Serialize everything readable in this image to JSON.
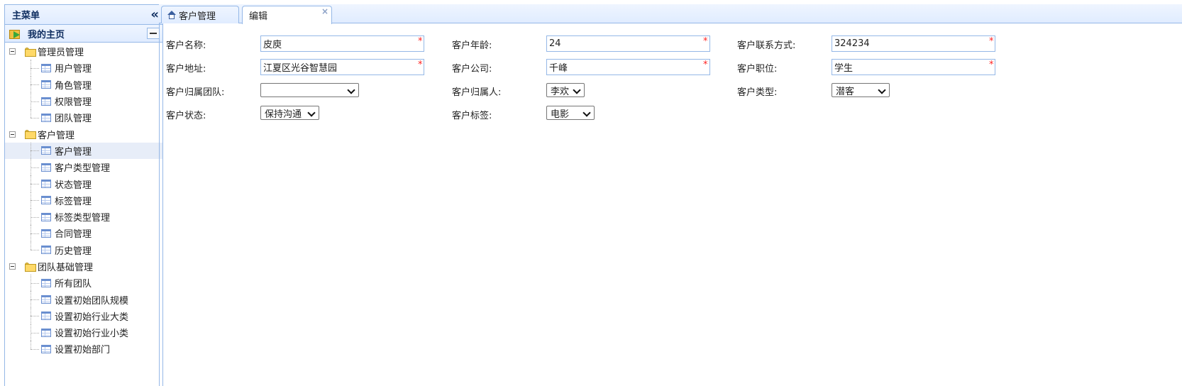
{
  "sidebar": {
    "title": "主菜单",
    "collapse_glyph": "«",
    "home_label": "我的主页",
    "groups": [
      {
        "label": "管理员管理",
        "children": [
          "用户管理",
          "角色管理",
          "权限管理",
          "团队管理"
        ]
      },
      {
        "label": "客户管理",
        "children": [
          "客户管理",
          "客户类型管理",
          "状态管理",
          "标签管理",
          "标签类型管理",
          "合同管理",
          "历史管理"
        ]
      },
      {
        "label": "团队基础管理",
        "children": [
          "所有团队",
          "设置初始团队规模",
          "设置初始行业大类",
          "设置初始行业小类",
          "设置初始部门"
        ]
      }
    ]
  },
  "tabs": {
    "customer": "客户管理",
    "edit": "编辑",
    "close_glyph": "×"
  },
  "form": {
    "required_mark": "*",
    "name_label": "客户名称:",
    "name_value": "皮庾",
    "age_label": "客户年龄:",
    "age_value": "24",
    "contact_label": "客户联系方式:",
    "contact_value": "324234",
    "address_label": "客户地址:",
    "address_value": "江夏区光谷智慧园",
    "company_label": "客户公司:",
    "company_value": "千峰",
    "position_label": "客户职位:",
    "position_value": "学生",
    "team_label": "客户归属团队:",
    "team_value": "",
    "owner_label": "客户归属人:",
    "owner_value": "李欢",
    "type_label": "客户类型:",
    "type_value": "潜客",
    "status_label": "客户状态:",
    "status_value": "保持沟通",
    "tag_label": "客户标签:",
    "tag_value": "电影"
  },
  "colors": {
    "border": "#95b8e7",
    "header_gradient_top": "#eff5ff",
    "header_gradient_bottom": "#e0ecff",
    "required": "#ff2222",
    "selected_row": "#e7edf8"
  }
}
